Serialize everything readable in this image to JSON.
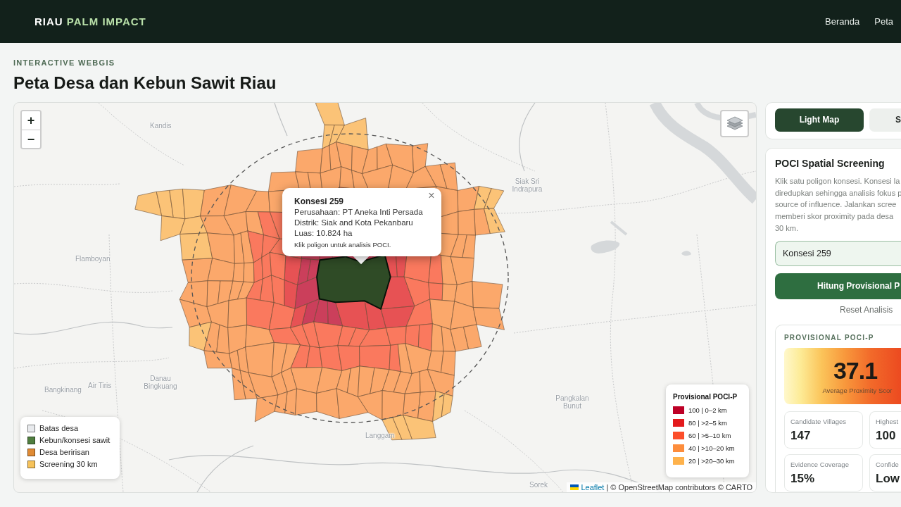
{
  "header": {
    "brand": {
      "primary": "RIAU",
      "accent": "PALM IMPACT"
    },
    "nav": [
      {
        "label": "Beranda",
        "selected": false
      },
      {
        "label": "Peta",
        "selected": false
      }
    ]
  },
  "page": {
    "eyebrow": "INTERACTIVE WEBGIS",
    "title": "Peta Desa dan Kebun Sawit Riau"
  },
  "map": {
    "zoom_controls": [
      "+",
      "−"
    ],
    "place_labels": [
      {
        "text": "Kandis"
      },
      {
        "text": "Flamboyan"
      },
      {
        "text": "Siak Sri Indrapura"
      },
      {
        "text": "Bangkinang"
      },
      {
        "text": "Air Tiris"
      },
      {
        "text": "Danau Bingkuang"
      },
      {
        "text": "Pangkalan Bunut"
      },
      {
        "text": "Sorek"
      },
      {
        "text": "Langgam"
      }
    ],
    "popup": {
      "title": "Konsesi 259",
      "lines": [
        "Perusahaan: PT Aneka Inti Persada",
        "Distrik: Siak and Kota Pekanbaru",
        "Luas: 10.824 ha"
      ],
      "hint": "Klik poligon untuk analisis POCI.",
      "close": "×"
    },
    "layer_legend": [
      {
        "label": "Batas desa",
        "color": "#e8eaed"
      },
      {
        "label": "Kebun/konsesi sawit",
        "color": "#4f7d3f"
      },
      {
        "label": "Desa beririsan",
        "color": "#df8a34"
      },
      {
        "label": "Screening 30 km",
        "color": "#f6c25a"
      }
    ],
    "score_legend": {
      "title": "Provisional POCI-P",
      "items": [
        {
          "label": "100 | 0–2 km",
          "color": "#bd0026"
        },
        {
          "label": "80 | >2–5 km",
          "color": "#e31a1c"
        },
        {
          "label": "60 | >5–10 km",
          "color": "#fc4e2a"
        },
        {
          "label": "40 | >10–20 km",
          "color": "#fd8d3c"
        },
        {
          "label": "20 | >20–30 km",
          "color": "#feb24c"
        }
      ]
    },
    "attribution": {
      "link": "Leaflet",
      "text": "| © OpenStreetMap contributors © CARTO"
    }
  },
  "basemap_buttons": [
    {
      "label": "Light Map",
      "selected": true
    },
    {
      "label": "S",
      "selected": false
    }
  ],
  "screening": {
    "title": "POCI Spatial Screening",
    "description_lines": [
      "Klik satu poligon konsesi. Konsesi la",
      "diredupkan sehingga analisis fokus p",
      "source of influence. Jalankan scree",
      "memberi skor proximity pada desa",
      "30 km."
    ],
    "selected_concession": "Konsesi 259",
    "run_button": "Hitung Provisional P",
    "reset_link": "Reset Analisis",
    "result": {
      "label": "PROVISIONAL POCI-P",
      "score": "37.1",
      "score_caption": "Average Proximity Scor",
      "stats": [
        {
          "label": "Candidate Villages",
          "value": "147"
        },
        {
          "label": "Highest",
          "value": "100"
        },
        {
          "label": "Evidence Coverage",
          "value": "15%"
        },
        {
          "label": "Confide",
          "value": "Low"
        }
      ]
    }
  }
}
